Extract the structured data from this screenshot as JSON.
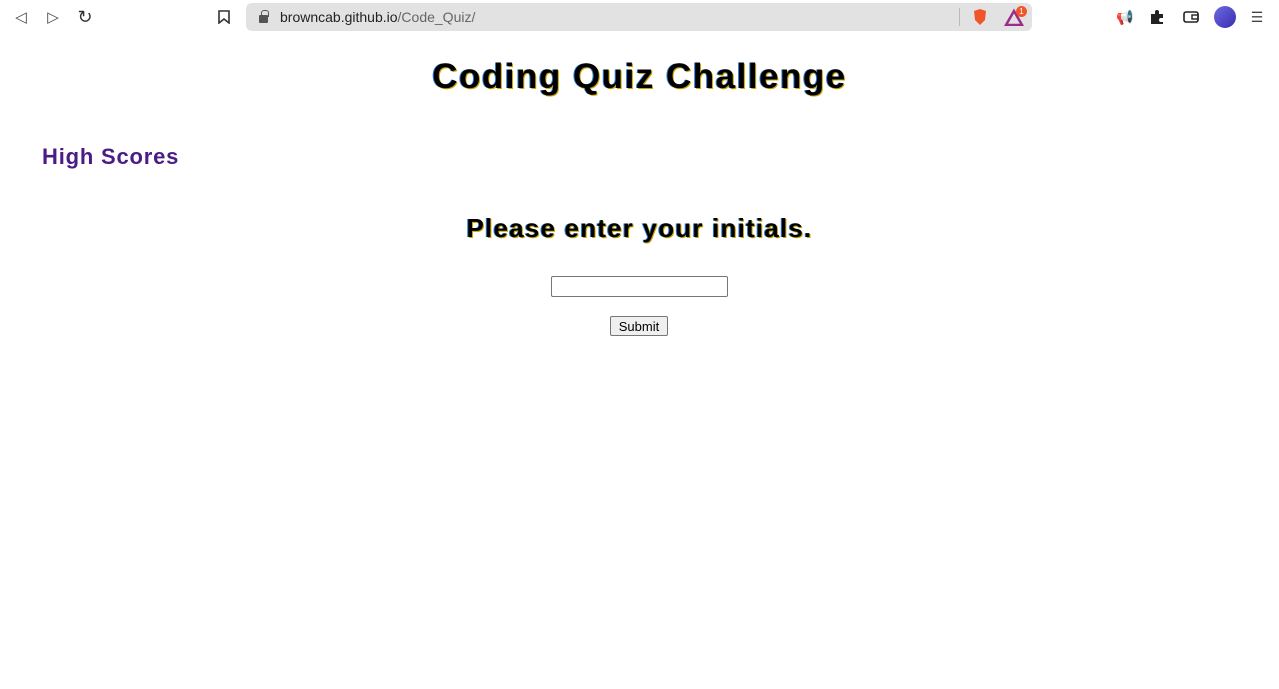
{
  "browser": {
    "url_host": "browncab.github.io",
    "url_path": "/Code_Quiz/",
    "rewards_badge": "1"
  },
  "page": {
    "title": "Coding Quiz Challenge",
    "high_scores_link": "High Scores",
    "prompt": "Please enter your initials.",
    "initials_value": "",
    "submit_label": "Submit"
  }
}
